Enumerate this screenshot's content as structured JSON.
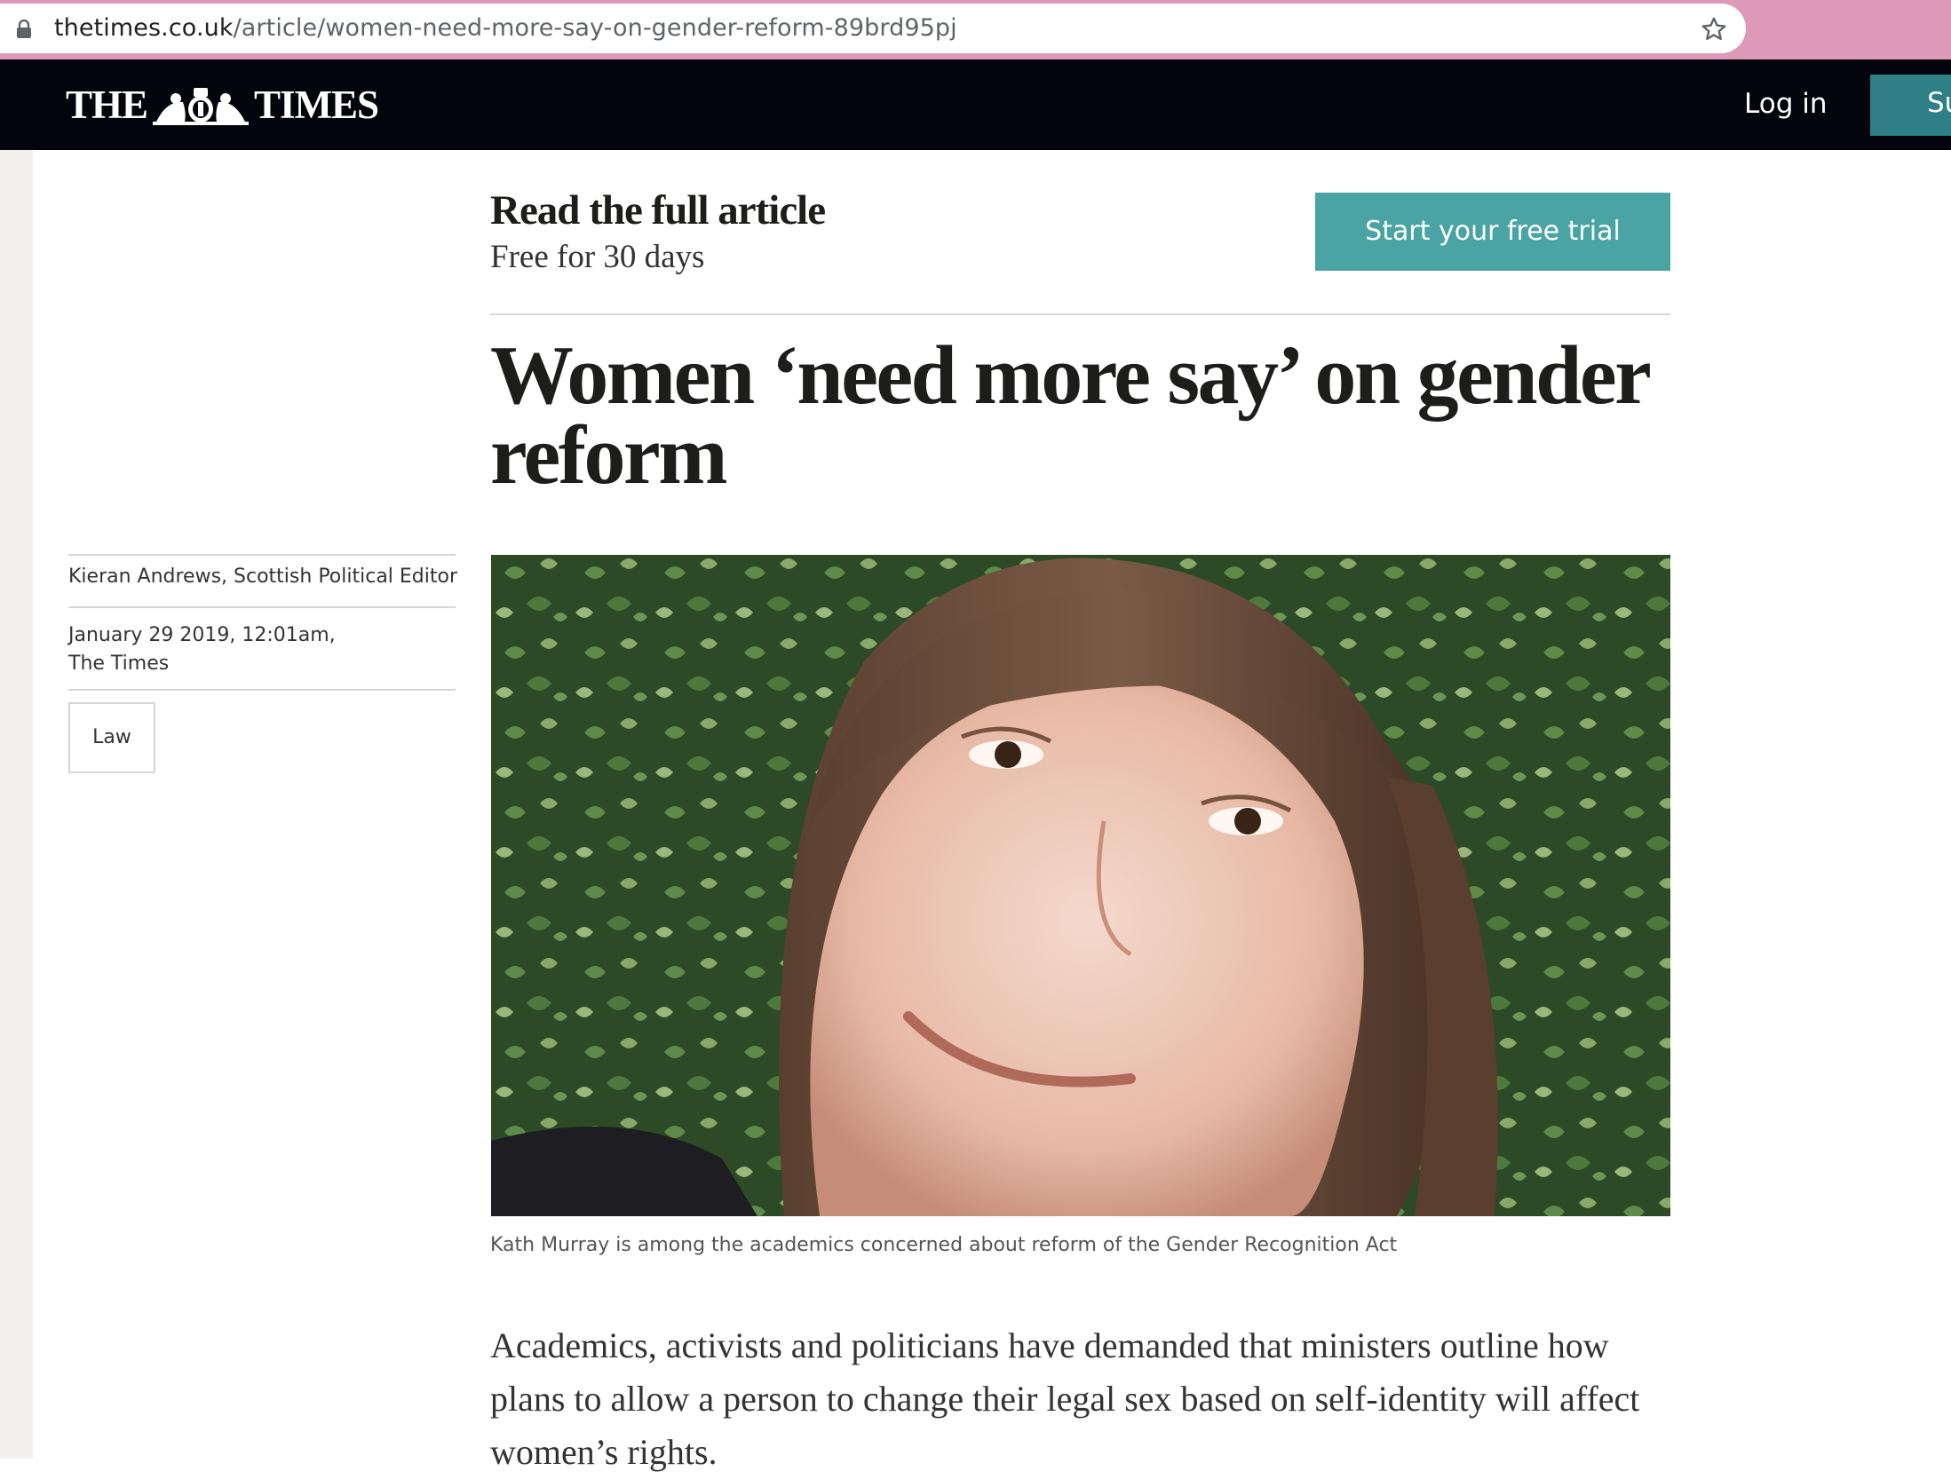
{
  "browser": {
    "url_host": "thetimes.co.uk",
    "url_path": "/article/women-need-more-say-on-gender-reform-89brd95pj",
    "lock_icon": "lock-icon",
    "bookmark_icon": "star-icon"
  },
  "header": {
    "logo_left": "THE",
    "logo_right": "TIMES",
    "crest_icon": "royal-crest-icon",
    "login_label": "Log in",
    "subscribe_label": "Subscribe"
  },
  "paywall": {
    "title": "Read the full article",
    "subtitle": "Free for 30 days",
    "trial_button": "Start your free trial"
  },
  "article": {
    "headline": "Women ‘need more say’ on gender reform",
    "author": "Kieran Andrews, Scottish Political Editor",
    "date": "January 29 2019, 12:01am,",
    "publication": "The Times",
    "tag": "Law",
    "image_caption": "Kath Murray is among the academics concerned about reform of the Gender Recognition Act",
    "body": "Academics, activists and politicians have demanded that ministers outline how plans to allow a person to change their legal sex based on self-identity will affect women’s rights."
  },
  "colors": {
    "browser_bar": "#dc9ab8",
    "header_bg": "#04040c",
    "subscribe_bg": "#2f7f86",
    "trial_button_bg": "#4ba4a4"
  }
}
